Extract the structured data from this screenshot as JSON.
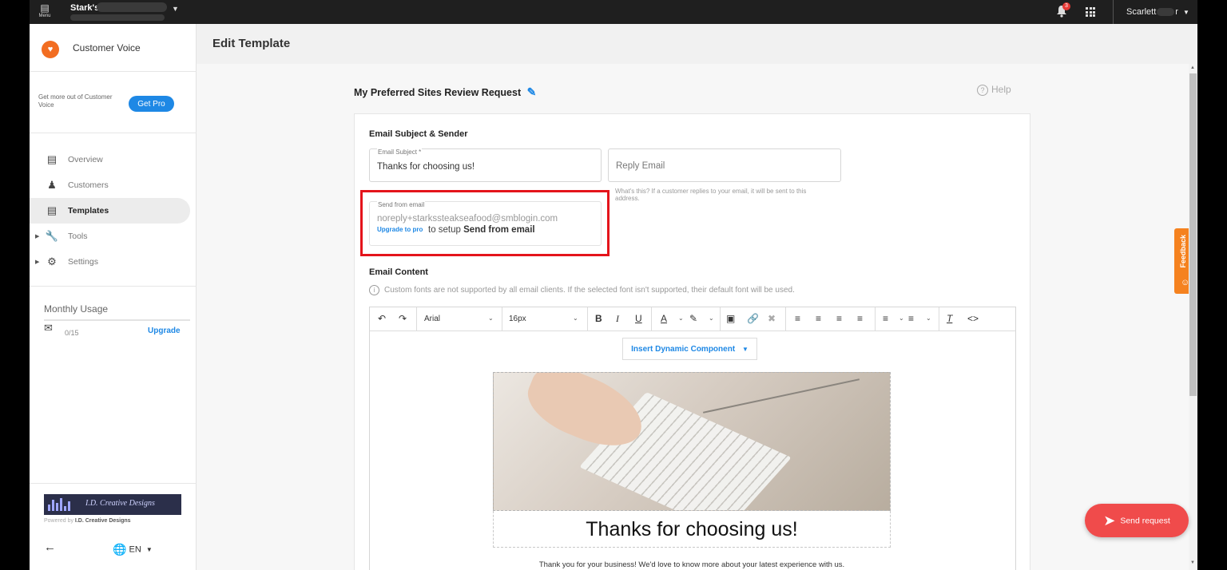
{
  "topbar": {
    "menu_label": "Menu",
    "business_name": "Stark's",
    "notification_count": "3",
    "user_name_start": "Scarlett",
    "user_name_end": "r"
  },
  "sidebar": {
    "brand": "Customer Voice",
    "promo_text": "Get more out of Customer Voice",
    "get_pro": "Get Pro",
    "items": [
      {
        "label": "Overview",
        "icon": "dashboard-icon",
        "active": false,
        "expandable": false
      },
      {
        "label": "Customers",
        "icon": "people-icon",
        "active": false,
        "expandable": false
      },
      {
        "label": "Templates",
        "icon": "template-icon",
        "active": true,
        "expandable": false
      },
      {
        "label": "Tools",
        "icon": "wrench-icon",
        "active": false,
        "expandable": true
      },
      {
        "label": "Settings",
        "icon": "gear-icon",
        "active": false,
        "expandable": true
      }
    ],
    "usage": {
      "title": "Monthly Usage",
      "count": "0/15",
      "upgrade": "Upgrade"
    },
    "partner": {
      "name": "I.D. Creative Designs",
      "powered_prefix": "Powered by",
      "powered_name": "I.D. Creative Designs"
    },
    "language": "EN"
  },
  "main": {
    "page_title": "Edit Template",
    "template_title": "My Preferred Sites Review Request",
    "help": "Help"
  },
  "email_form": {
    "section_title": "Email Subject & Sender",
    "subject_label": "Email Subject *",
    "subject_value": "Thanks for choosing us!",
    "reply_placeholder": "Reply Email",
    "reply_hint": "What's this? If a customer replies to your email, it will be sent to this address.",
    "send_from_label": "Send from email",
    "send_from_value": "noreply+starkssteakseafood@smblogin.com",
    "upgrade_link": "Upgrade to pro",
    "upgrade_rest": "to setup",
    "upgrade_bold": "Send from email"
  },
  "content": {
    "section_title": "Email Content",
    "font_notice": "Custom fonts are not supported by all email clients. If the selected font isn't supported, their default font will be used.",
    "font_family": "Arial",
    "font_size": "16px",
    "dynamic_component": "Insert Dynamic Component",
    "heading": "Thanks for choosing us!",
    "body": "Thank you for your business! We'd love to know more about your latest experience with us."
  },
  "widgets": {
    "feedback": "Feedback",
    "send_request": "Send request"
  },
  "colors": {
    "primary": "#1e88e5",
    "accent_orange": "#f5821f",
    "send_red": "#f04b4b",
    "highlight_red": "#e4141b"
  }
}
